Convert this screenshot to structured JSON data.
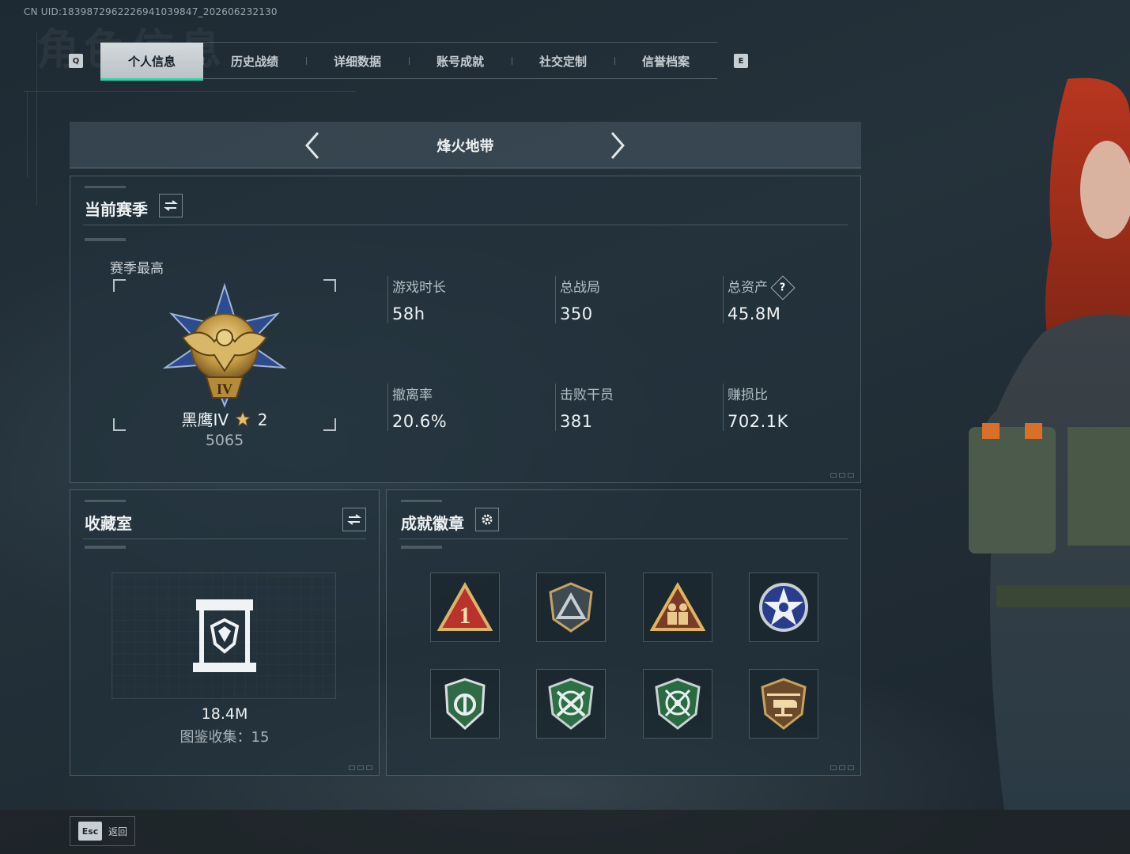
{
  "uid_text": "CN UID:1839872962226941039847_202606232130",
  "tabs": {
    "left_key": "Q",
    "right_key": "E",
    "items": [
      {
        "label": "个人信息",
        "active": true
      },
      {
        "label": "历史战绩",
        "active": false
      },
      {
        "label": "详细数据",
        "active": false
      },
      {
        "label": "账号成就",
        "active": false
      },
      {
        "label": "社交定制",
        "active": false
      },
      {
        "label": "信誉档案",
        "active": false
      }
    ]
  },
  "mode": {
    "title": "烽火地带"
  },
  "season": {
    "title": "当前赛季",
    "best_label": "赛季最高",
    "rank_name": "黑鹰IV",
    "rank_stars": "2",
    "rank_score": "5065",
    "rank_emblem_numeral": "IV",
    "stats": [
      {
        "label": "游戏时长",
        "value": "58h"
      },
      {
        "label": "总战局",
        "value": "350"
      },
      {
        "label": "总资产",
        "value": "45.8M",
        "help": "?"
      },
      {
        "label": "撤离率",
        "value": "20.6%"
      },
      {
        "label": "击败干员",
        "value": "381"
      },
      {
        "label": "赚损比",
        "value": "702.1K"
      }
    ]
  },
  "collection": {
    "title": "收藏室",
    "value": "18.4M",
    "count_text": "图鉴收集：15"
  },
  "achievements": {
    "title": "成就徽章",
    "badges": [
      {
        "icon": "triangle-rank-1-badge",
        "label": "1"
      },
      {
        "icon": "shield-triangle-badge"
      },
      {
        "icon": "triangle-soldiers-badge"
      },
      {
        "icon": "star-emblem-badge"
      },
      {
        "icon": "green-shield-badge"
      },
      {
        "icon": "crossed-rifles-badge"
      },
      {
        "icon": "crossed-knives-badge"
      },
      {
        "icon": "helicopter-shield-badge"
      }
    ]
  },
  "footer": {
    "esc_key": "Esc",
    "back_label": "返回"
  },
  "colors": {
    "accent": "#2fd6a3",
    "gold": "#c9a24a",
    "panel_border": "#5e6e78"
  }
}
